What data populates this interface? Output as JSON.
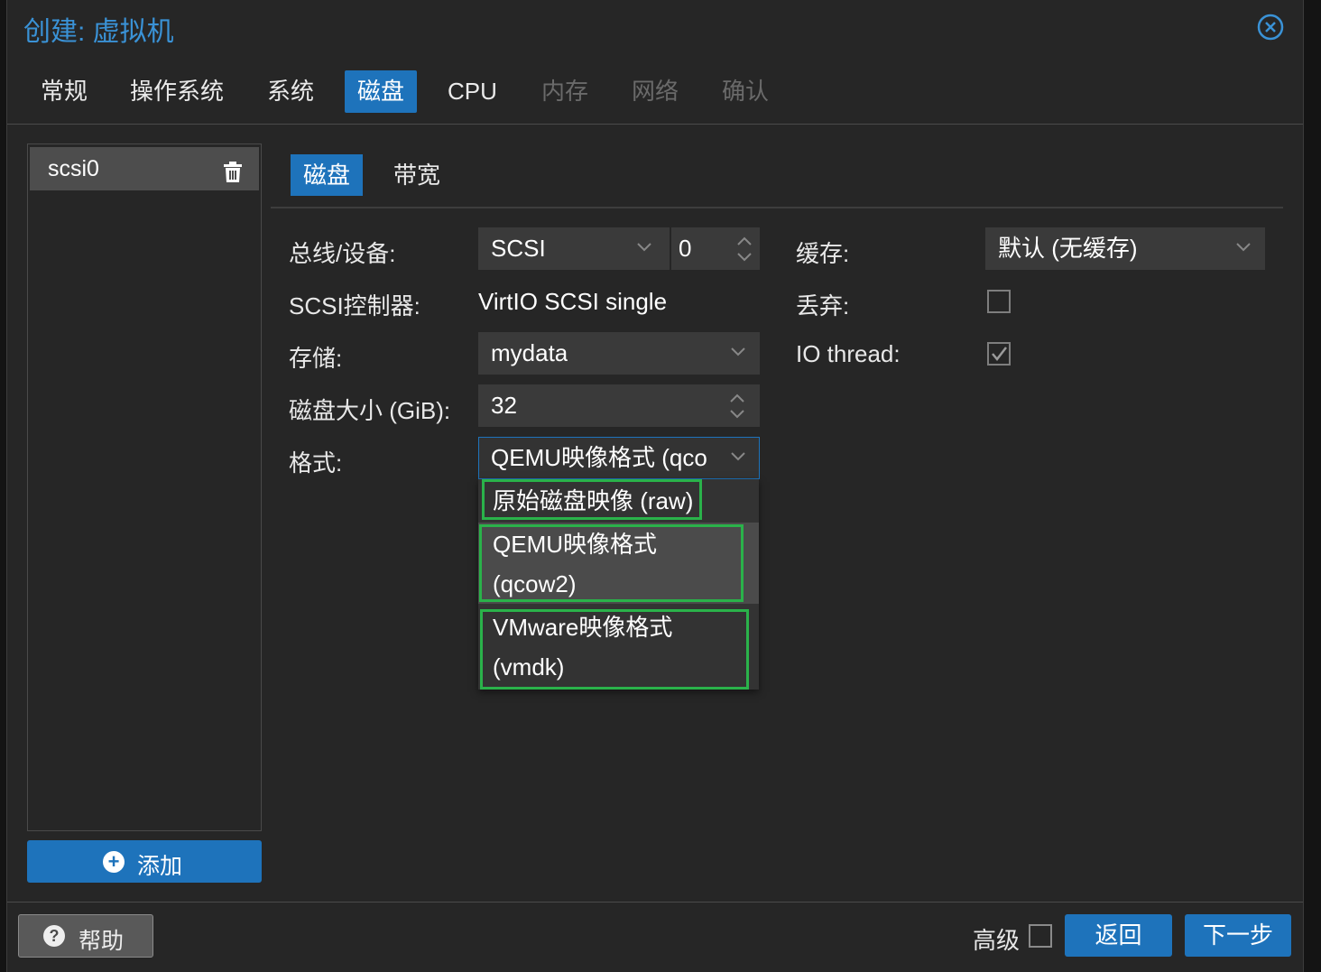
{
  "window": {
    "title": "创建: 虚拟机"
  },
  "tabs": [
    {
      "label": "常规",
      "state": "normal"
    },
    {
      "label": "操作系统",
      "state": "normal"
    },
    {
      "label": "系统",
      "state": "normal"
    },
    {
      "label": "磁盘",
      "state": "active"
    },
    {
      "label": "CPU",
      "state": "normal"
    },
    {
      "label": "内存",
      "state": "disabled"
    },
    {
      "label": "网络",
      "state": "disabled"
    },
    {
      "label": "确认",
      "state": "disabled"
    }
  ],
  "disk_list": {
    "items": [
      {
        "label": "scsi0"
      }
    ],
    "add_label": "添加"
  },
  "subtabs": [
    {
      "label": "磁盘",
      "state": "active"
    },
    {
      "label": "带宽",
      "state": "normal"
    }
  ],
  "form": {
    "bus_label": "总线/设备:",
    "bus_value": "SCSI",
    "device_value": "0",
    "controller_label": "SCSI控制器:",
    "controller_value": "VirtIO SCSI single",
    "storage_label": "存储:",
    "storage_value": "mydata",
    "size_label": "磁盘大小 (GiB):",
    "size_value": "32",
    "format_label": "格式:",
    "format_value": "QEMU映像格式 (qco",
    "cache_label": "缓存:",
    "cache_value": "默认 (无缓存)",
    "discard_label": "丢弃:",
    "discard_checked": false,
    "iothread_label": "IO thread:",
    "iothread_checked": true
  },
  "format_dropdown": {
    "options": [
      {
        "line1": "原始磁盘映像 (raw)",
        "line2": ""
      },
      {
        "line1": "QEMU映像格式",
        "line2": "(qcow2)",
        "selected": true
      },
      {
        "line1": "VMware映像格式",
        "line2": "(vmdk)"
      }
    ]
  },
  "footer": {
    "help_label": "帮助",
    "advanced_label": "高级",
    "advanced_checked": false,
    "back_label": "返回",
    "next_label": "下一步"
  },
  "colors": {
    "accent": "#1e73bb",
    "title": "#3a92d6",
    "highlight_box": "#2ab24a",
    "background": "#262626"
  }
}
